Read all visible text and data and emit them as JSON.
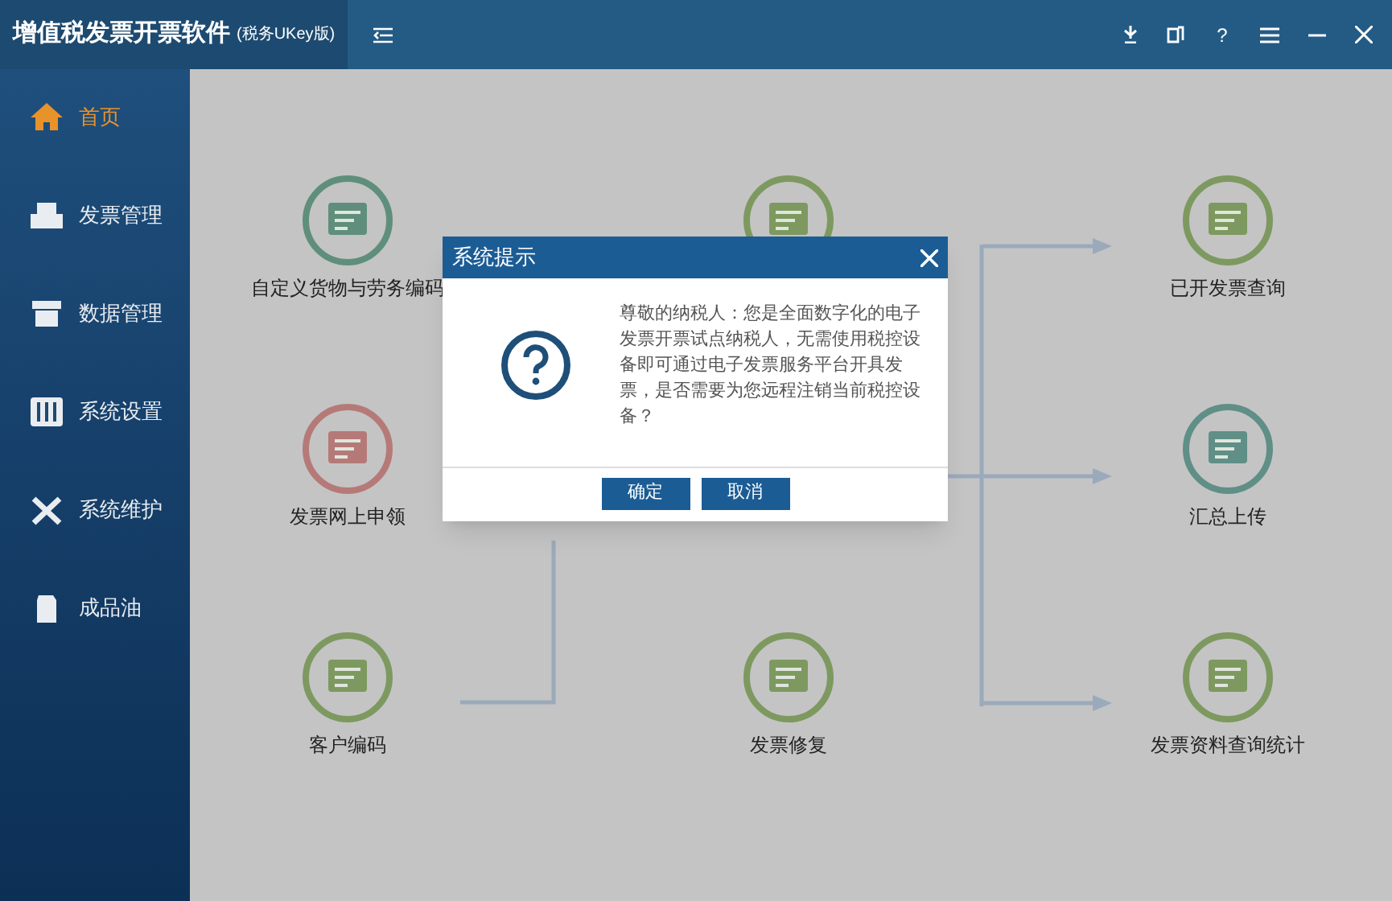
{
  "window": {
    "title": "增值税发票开票软件",
    "subtitle": "(税务UKey版)",
    "help": "?"
  },
  "sidebar": {
    "items": [
      {
        "label": "首页",
        "selected": true
      },
      {
        "label": "发票管理",
        "selected": false
      },
      {
        "label": "数据管理",
        "selected": false
      },
      {
        "label": "系统设置",
        "selected": false
      },
      {
        "label": "系统维护",
        "selected": false
      },
      {
        "label": "成品油",
        "selected": false
      }
    ]
  },
  "modules": [
    {
      "label": "自定义货物与劳务编码",
      "color": "#5f8f7c"
    },
    {
      "label": "发票网上申领",
      "color": "#b57a78"
    },
    {
      "label": "客户编码",
      "color": "#7d9960"
    },
    {
      "color": "#7d9960"
    },
    {
      "label": "发票修复",
      "color": "#7d9960"
    },
    {
      "label": "已开发票查询",
      "color": "#7d9960"
    },
    {
      "label": "汇总上传",
      "color": "#5f8f86"
    },
    {
      "label": "发票资料查询统计",
      "color": "#7d9960"
    }
  ],
  "dialog": {
    "title": "系统提示",
    "message": "尊敬的纳税人：您是全面数字化的电子发票开票试点纳税人，无需使用税控设备即可通过电子发票服务平台开具发票，是否需要为您远程注销当前税控设备？",
    "buttons": [
      "确定",
      "取消"
    ]
  }
}
